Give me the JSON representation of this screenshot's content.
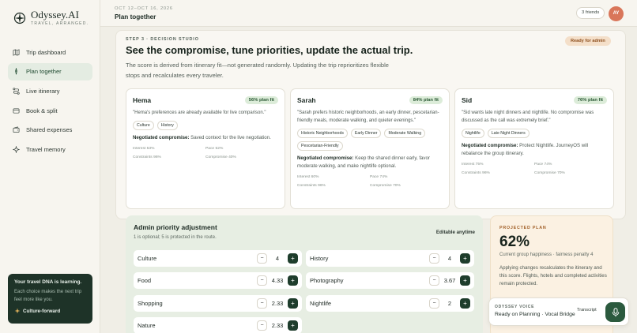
{
  "brand": {
    "name": "Odyssey.AI",
    "tagline": "TRAVEL, ARRANGED."
  },
  "sidebar": {
    "items": [
      {
        "label": "Trip dashboard",
        "icon": "map-icon"
      },
      {
        "label": "Plan together",
        "icon": "compass-pin-icon",
        "active": true
      },
      {
        "label": "Live itinerary",
        "icon": "route-icon"
      },
      {
        "label": "Book & split",
        "icon": "card-icon"
      },
      {
        "label": "Shared expenses",
        "icon": "wallet-icon"
      },
      {
        "label": "Travel memory",
        "icon": "sparkle-icon"
      }
    ]
  },
  "dna": {
    "title": "Your travel DNA is learning.",
    "text": "Each choice makes the next trip feel more like you.",
    "badge": "Culture-forward"
  },
  "header": {
    "dates": "OCT 12–OCT 16, 2026",
    "title": "Plan together",
    "friends": "3 friends",
    "avatar": "AY"
  },
  "studio": {
    "step": "STEP 3 · DECISION STUDIO",
    "headline": "See the compromise, tune priorities, update the actual trip.",
    "description": "The score is derived from itinerary fit—not generated randomly. Updating the trip reprioritizes flexible stops and recalculates every traveler.",
    "status": "Ready for admin",
    "travelers": [
      {
        "name": "Hema",
        "fit": "56% plan fit",
        "quote": "\"Hema's preferences are already available for live comparison.\"",
        "tags": [
          "Culture",
          "History"
        ],
        "neg_label": "Negotiated compromise:",
        "neg_text": " Saved context for the live negotiation.",
        "stats": [
          "Interest 53%",
          "Pace 52%",
          "Constraints 96%",
          "Compromise 40%"
        ]
      },
      {
        "name": "Sarah",
        "fit": "84% plan fit",
        "quote": "\"Sarah prefers historic neighborhoods, an early dinner, pescetarian-friendly meals, moderate walking, and quieter evenings.\"",
        "tags": [
          "Historic Neighborhoods",
          "Early Dinner",
          "Moderate Walking",
          "Pescetarian-Friendly"
        ],
        "neg_label": "Negotiated compromise:",
        "neg_text": " Keep the shared dinner early, favor moderate walking, and make nightlife optional.",
        "stats": [
          "Interest 60%",
          "Pace 74%",
          "Constraints 96%",
          "Compromise 70%"
        ]
      },
      {
        "name": "Sid",
        "fit": "76% plan fit",
        "quote": "\"Sid wants late night dinners and nightlife. No compromise was discussed as the call was extremely brief.\"",
        "tags": [
          "Nightlife",
          "Late Night Dinners"
        ],
        "neg_label": "Negotiated compromise:",
        "neg_text": " Protect Nightlife. JourneyOS will rebalance the group itinerary.",
        "stats": [
          "Interest 75%",
          "Pace 74%",
          "Constraints 96%",
          "Compromise 70%"
        ]
      }
    ]
  },
  "admin": {
    "title": "Admin priority adjustment",
    "subtitle": "1 is optional; 5 is protected in the route.",
    "editable": "Editable anytime",
    "minus": "−",
    "plus": "+",
    "priorities": [
      {
        "label": "Culture",
        "value": "4"
      },
      {
        "label": "History",
        "value": "4"
      },
      {
        "label": "Food",
        "value": "4.33"
      },
      {
        "label": "Photography",
        "value": "3.67"
      },
      {
        "label": "Shopping",
        "value": "2.33"
      },
      {
        "label": "Nightlife",
        "value": "2"
      },
      {
        "label": "Nature",
        "value": "2.33"
      }
    ]
  },
  "projected": {
    "label": "PROJECTED PLAN",
    "percent": "62%",
    "subtitle": "Current group happiness · fairness penalty 4",
    "description": "Applying changes recalculates the itinerary and this score. Flights, hotels and completed activities remain protected."
  },
  "voice": {
    "label": "ODYSSEY VOICE",
    "status": "Ready on Planning · Vocal Bridge",
    "transcript": "Transcript"
  },
  "colors": {
    "accent": "#1e3d2c",
    "fit_bg": "#dcecd9",
    "ready_bg": "#f4dfc9",
    "avatar": "#d9765a"
  }
}
